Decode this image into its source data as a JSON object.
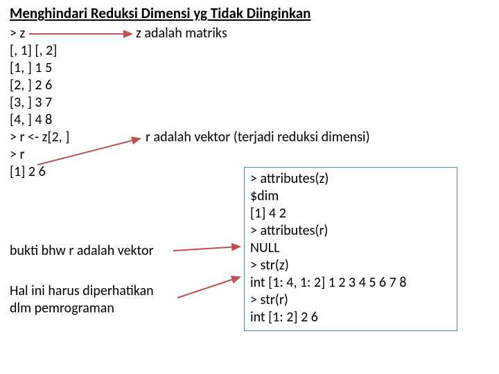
{
  "title": "Menghindari Reduksi Dimensi yg Tidak Diinginkan",
  "code_left": "> z\n[, 1] [, 2]\n[1, ] 1 5\n[2, ] 2 6\n[3, ] 3 7\n[4, ] 4 8\n> r <- z[2, ]\n> r\n[1] 2 6",
  "note_z": "z adalah matriks",
  "note_r": "r adalah vektor (terjadi reduksi dimensi)",
  "bukti": "bukti bhw r adalah vektor",
  "hal": "Hal ini harus diperhatikan\ndlm pemrograman",
  "box": "> attributes(z)\n$dim\n[1] 4 2\n> attributes(r)\nNULL\n> str(z)\nint [1: 4, 1: 2] 1 2 3 4 5 6 7 8\n> str(r)\nint [1: 2] 2 6"
}
